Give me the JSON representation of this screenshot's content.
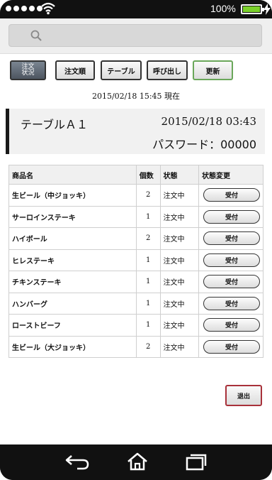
{
  "status_bar": {
    "battery_percent": "100%",
    "signal_dots": 5,
    "battery_color": "#7bd12b"
  },
  "toolbar": {
    "order_status_label_line1": "注文",
    "order_status_label_line2": "状況",
    "order_sort_label": "注文順",
    "table_label": "テーブル",
    "call_label": "呼び出し",
    "refresh_label": "更新"
  },
  "current_datetime": "2015/02/18 15:45 現在",
  "table_info": {
    "name": "テーブルＡ１",
    "datetime": "2015/02/18 03:43",
    "password": "パスワード：00000"
  },
  "orders": {
    "headers": [
      "商品名",
      "個数",
      "状態",
      "状態変更"
    ],
    "rows": [
      {
        "name": "生ビール（中ジョッキ）",
        "qty": "2",
        "state": "注文中",
        "action": "受付"
      },
      {
        "name": "サーロインステーキ",
        "qty": "1",
        "state": "注文中",
        "action": "受付"
      },
      {
        "name": "ハイボール",
        "qty": "2",
        "state": "注文中",
        "action": "受付"
      },
      {
        "name": "ヒレステーキ",
        "qty": "1",
        "state": "注文中",
        "action": "受付"
      },
      {
        "name": "チキンステーキ",
        "qty": "1",
        "state": "注文中",
        "action": "受付"
      },
      {
        "name": "ハンバーグ",
        "qty": "1",
        "state": "注文中",
        "action": "受付"
      },
      {
        "name": "ローストビーフ",
        "qty": "1",
        "state": "注文中",
        "action": "受付"
      },
      {
        "name": "生ビール（大ジョッキ）",
        "qty": "2",
        "state": "注文中",
        "action": "受付"
      }
    ]
  },
  "exit_label": "退出",
  "icons": [
    "wifi-icon",
    "battery-icon",
    "charging-icon",
    "search-icon",
    "back-icon",
    "home-icon",
    "recent-apps-icon"
  ]
}
